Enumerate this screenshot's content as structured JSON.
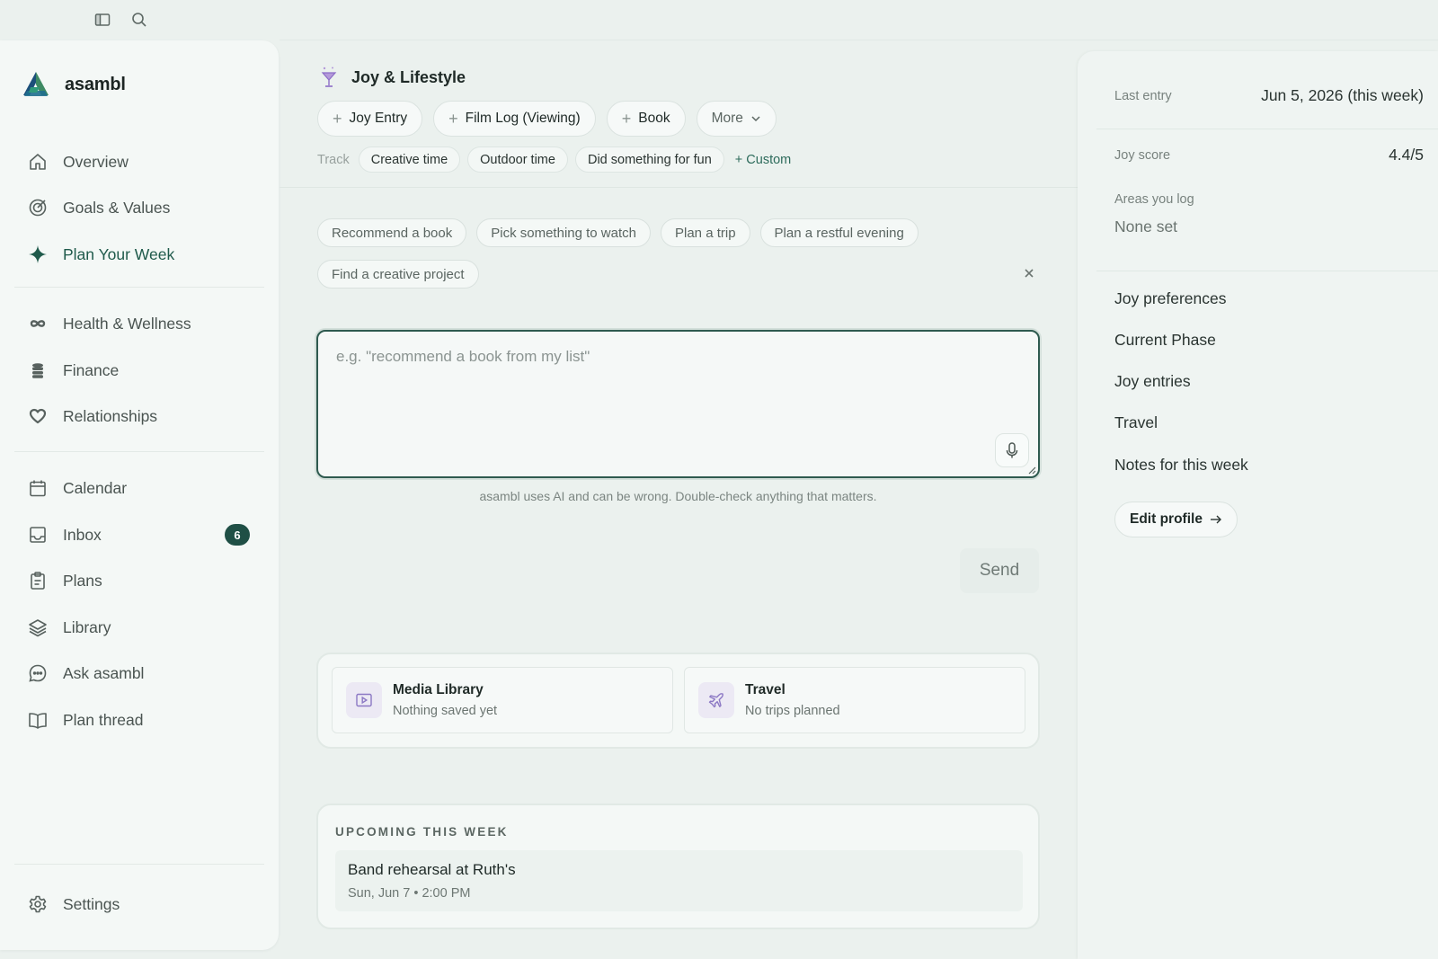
{
  "topbar": {
    "icons": [
      "sidebar-toggle-icon",
      "search-icon"
    ]
  },
  "sidebar": {
    "brand": "asambl",
    "nav_primary": [
      {
        "label": "Overview",
        "icon": "home-icon"
      },
      {
        "label": "Goals & Values",
        "icon": "target-icon"
      },
      {
        "label": "Plan Your Week",
        "icon": "sparkle-icon",
        "active": true
      }
    ],
    "nav_areas": [
      {
        "label": "Health & Wellness",
        "icon": "infinity-icon"
      },
      {
        "label": "Finance",
        "icon": "coins-icon"
      },
      {
        "label": "Relationships",
        "icon": "heart-icon"
      }
    ],
    "nav_tools": [
      {
        "label": "Calendar",
        "icon": "calendar-icon"
      },
      {
        "label": "Inbox",
        "icon": "inbox-icon",
        "badge": "6"
      },
      {
        "label": "Plans",
        "icon": "clipboard-icon"
      },
      {
        "label": "Library",
        "icon": "layers-icon"
      },
      {
        "label": "Ask asambl",
        "icon": "chat-icon"
      },
      {
        "label": "Plan thread",
        "icon": "book-icon"
      }
    ],
    "settings": "Settings"
  },
  "main": {
    "title": "Joy & Lifestyle",
    "actions": [
      "Joy Entry",
      "Film Log (Viewing)",
      "Book"
    ],
    "more": "More",
    "track_label": "Track",
    "track_chips": [
      "Creative time",
      "Outdoor time",
      "Did something for fun"
    ],
    "custom": "+ Custom",
    "suggestions": [
      "Recommend a book",
      "Pick something to watch",
      "Plan a trip",
      "Plan a restful evening",
      "Find a creative project"
    ],
    "composer_placeholder": "e.g. \"recommend a book from my list\"",
    "disclaimer": "asambl uses AI and can be wrong. Double-check anything that matters.",
    "send": "Send",
    "cards": [
      {
        "title": "Media Library",
        "subtitle": "Nothing saved yet",
        "icon": "play-icon"
      },
      {
        "title": "Travel",
        "subtitle": "No trips planned",
        "icon": "plane-icon"
      }
    ],
    "upcoming": {
      "heading": "UPCOMING THIS WEEK",
      "items": [
        {
          "title": "Band rehearsal at Ruth's",
          "when": "Sun, Jun 7 • 2:00 PM"
        }
      ]
    }
  },
  "panel": {
    "last_entry_label": "Last entry",
    "last_entry_value": "Jun 5, 2026 (this week)",
    "joy_score_label": "Joy score",
    "joy_score_value": "4.4/5",
    "areas_label": "Areas you log",
    "areas_value": "None set",
    "links": [
      "Joy preferences",
      "Current Phase",
      "Joy entries",
      "Travel",
      "Notes for this week"
    ],
    "edit_profile": "Edit profile"
  },
  "colors": {
    "accent": "#1f5a4b",
    "badge": "#1f4f45",
    "card_icon": "#8c78c4"
  }
}
